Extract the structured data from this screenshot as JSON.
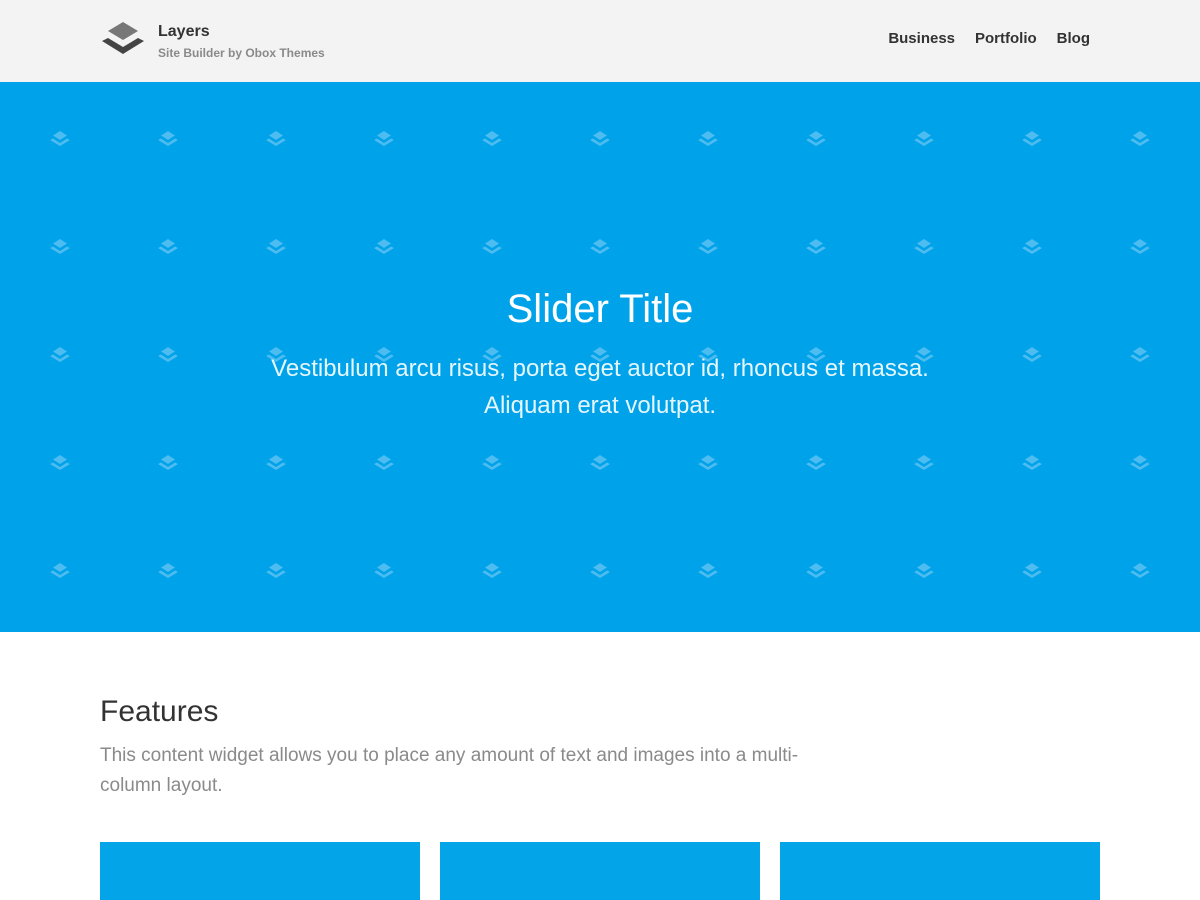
{
  "header": {
    "site_title": "Layers",
    "tagline": "Site Builder by Obox Themes",
    "nav": [
      {
        "label": "Business"
      },
      {
        "label": "Portfolio"
      },
      {
        "label": "Blog"
      }
    ],
    "logo_icon": "layers-logo-icon",
    "background": "#f3f3f3"
  },
  "slider": {
    "title": "Slider Title",
    "excerpt": "Vestibulum arcu risus, porta eget auctor id, rhoncus et massa. Aliquam erat volutpat.",
    "background": "#00a3e9",
    "pattern_icon": "layers-pattern-icon"
  },
  "features": {
    "title": "Features",
    "excerpt": "This content widget allows you to place any amount of text and images into a multi-column layout.",
    "column_color": "#03a4e8"
  }
}
